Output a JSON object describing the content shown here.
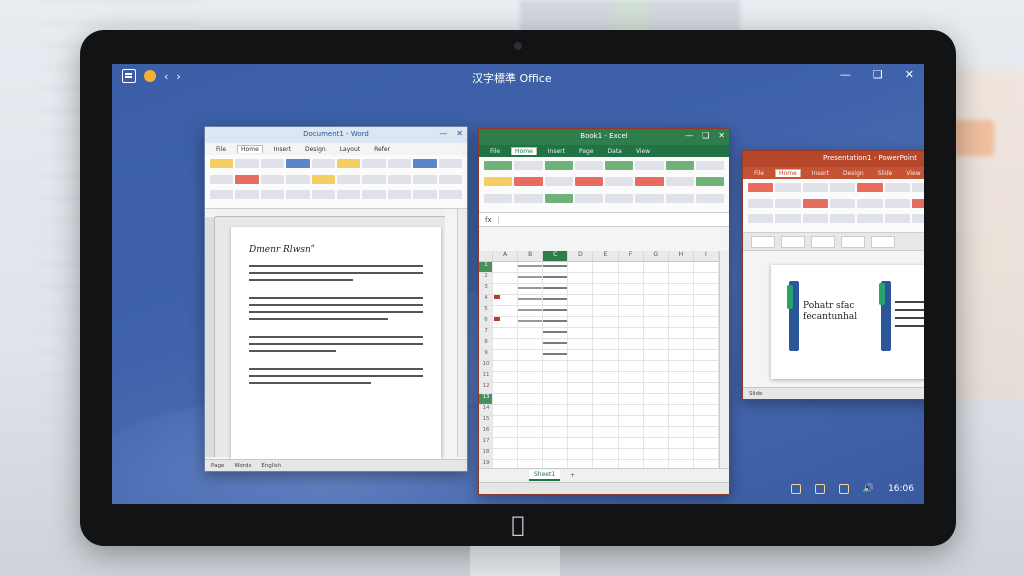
{
  "screen": {
    "title": "汉字標準 Office",
    "window_controls": [
      "—",
      "❑",
      "✕"
    ]
  },
  "word": {
    "title": "Document1 - Word",
    "tabs": [
      "File",
      "Home",
      "Insert",
      "Design",
      "Layout",
      "Refer"
    ],
    "active_tab": "Home",
    "doc_title": "Dmenr Rlwsnʺ",
    "status": [
      "Page",
      "Words",
      "English"
    ]
  },
  "excel": {
    "title": "Book1 - Excel",
    "tabs": [
      "File",
      "Home",
      "Insert",
      "Page",
      "Data",
      "View"
    ],
    "active_tab": "Home",
    "formula_prefix": "fx",
    "columns": [
      "A",
      "B",
      "C",
      "D",
      "E",
      "F",
      "G",
      "H",
      "I"
    ],
    "selected_column": "C",
    "rows": [
      "1",
      "2",
      "3",
      "4",
      "5",
      "6",
      "7",
      "8",
      "9",
      "10",
      "11",
      "12",
      "13",
      "14",
      "15",
      "16",
      "17",
      "18",
      "19",
      "20"
    ],
    "sheet_tab": "Sheet1",
    "add_sheet": "+"
  },
  "ppt": {
    "title": "Presentation1 - PowerPoint",
    "tabs": [
      "File",
      "Home",
      "Insert",
      "Design",
      "Slide",
      "View"
    ],
    "active_tab": "Home",
    "slide_title": "Pohatr sfac fecantunhal",
    "status": "Slide"
  },
  "tray": {
    "volume_icon": "speaker-icon",
    "clock": "16:06"
  }
}
